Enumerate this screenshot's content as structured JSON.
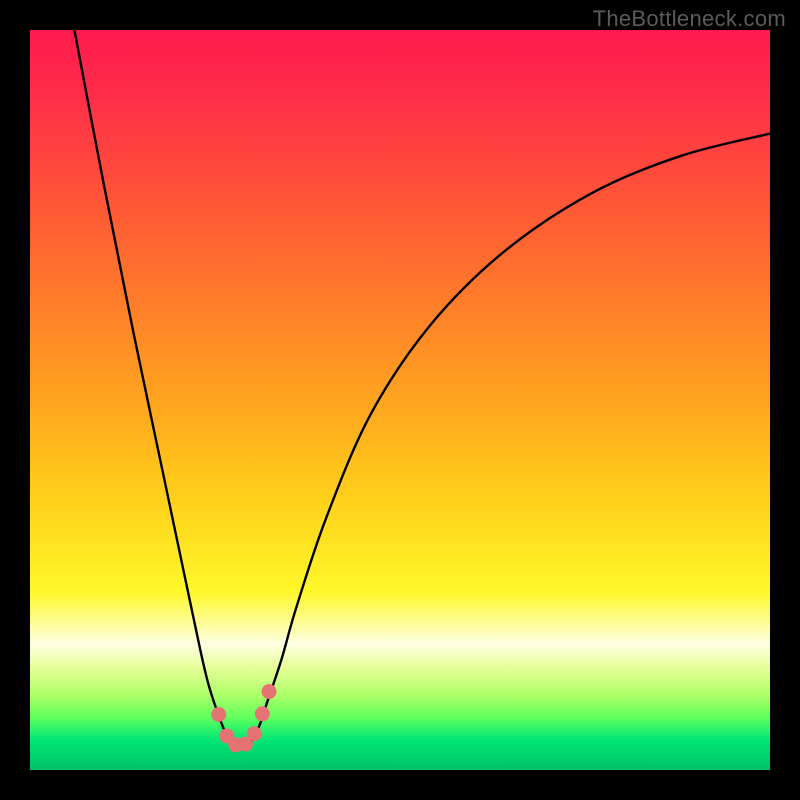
{
  "watermark": "TheBottleneck.com",
  "chart_data": {
    "type": "line",
    "title": "",
    "xlabel": "",
    "ylabel": "",
    "xlim": [
      0,
      100
    ],
    "ylim": [
      0,
      100
    ],
    "grid": false,
    "legend": false,
    "series": [
      {
        "name": "bottleneck-curve",
        "color": "#000000",
        "x": [
          6,
          10,
          14,
          18,
          22,
          24,
          26,
          27,
          28,
          29,
          30,
          31,
          32,
          34,
          36,
          40,
          46,
          54,
          64,
          76,
          88,
          100
        ],
        "y": [
          100,
          79,
          59,
          40,
          21,
          12,
          6,
          4,
          3,
          3,
          4,
          6,
          9,
          15,
          22,
          34,
          48,
          60,
          70,
          78,
          83,
          86
        ]
      }
    ],
    "markers": {
      "name": "bottleneck-bottom-dots",
      "color": "#e57373",
      "points": [
        {
          "x": 25.5,
          "y": 7.5
        },
        {
          "x": 26.6,
          "y": 4.6
        },
        {
          "x": 27.8,
          "y": 3.4
        },
        {
          "x": 29.1,
          "y": 3.5
        },
        {
          "x": 30.3,
          "y": 4.9
        },
        {
          "x": 31.4,
          "y": 7.6
        },
        {
          "x": 32.3,
          "y": 10.6
        }
      ]
    },
    "background_gradient_note": "vertical gradient red→orange→yellow→green; curve minimum sits in green zone"
  }
}
